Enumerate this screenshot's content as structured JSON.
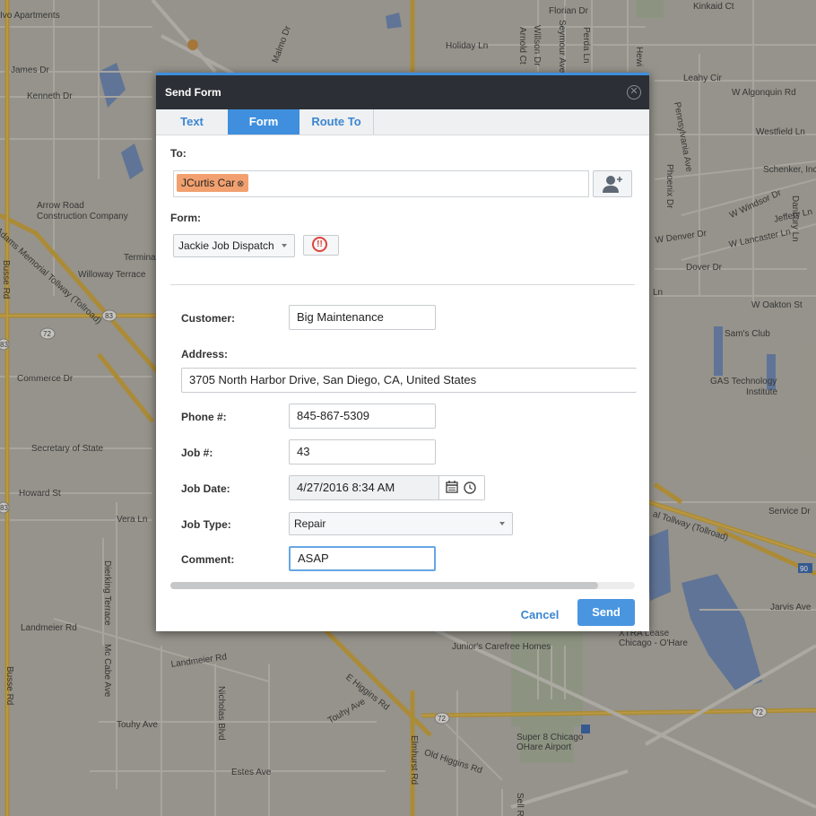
{
  "dialog": {
    "title": "Send Form",
    "close_icon": "close-circle-icon",
    "tabs": [
      {
        "label": "Text",
        "active": false
      },
      {
        "label": "Form",
        "active": true
      },
      {
        "label": "Route To",
        "active": false
      }
    ],
    "to_label": "To:",
    "recipient_chip": "JCurtis Car",
    "add_contact_icon": "add-user-icon",
    "form_label": "Form:",
    "form_selected": "Jackie Job Dispatch",
    "priority_icon": "priority-alert-icon",
    "fields": {
      "customer_label": "Customer:",
      "customer_value": "Big Maintenance",
      "address_label": "Address:",
      "address_value": "3705 North Harbor Drive, San Diego, CA, United States",
      "phone_label": "Phone #:",
      "phone_value": "845-867-5309",
      "job_label": "Job #:",
      "job_value": "43",
      "jobdate_label": "Job Date:",
      "jobdate_value": "4/27/2016 8:34 AM",
      "jobtype_label": "Job Type:",
      "jobtype_value": "Repair",
      "comment_label": "Comment:",
      "comment_value": "ASAP"
    },
    "cancel_label": "Cancel",
    "send_label": "Send",
    "colors": {
      "accent": "#3f8fde",
      "header": "#2c3036",
      "chip": "#f2a06f",
      "alert": "#e0433c"
    }
  },
  "map": {
    "labels": [
      "Ivo Apartments",
      "James Dr",
      "Kenneth Dr",
      "Arrow Road",
      "Construction Company",
      "Willoway Terrace",
      "Termina",
      "Commerce Dr",
      "Secretary of State",
      "Howard St",
      "Vera Ln",
      "Landmeier Rd",
      "Landmeier Rd",
      "Touhy Ave",
      "Estes Ave",
      "Busse Rd",
      "Busse Rd",
      "Dierking Terrace",
      "Mc Cabe Ave",
      "Nicholas Blvd",
      "Elmhurst Rd",
      "Sell R",
      "Holiday Ln",
      "Malmo Dr",
      "Arnold Ct",
      "Willson Dr",
      "Seymour Ave",
      "Perda Ln",
      "Hewi",
      "Florian Dr",
      "Kinkaid Ct",
      "Leahy Cir",
      "W Algonquin Rd",
      "Westfield Ln",
      "Schenker, Inc",
      "W Windsor Dr",
      "Jeffery Ln",
      "Danbury Ln",
      "W Denver Dr",
      "W Lancaster Ln",
      "Dover Dr",
      "Ln",
      "W Oakton St",
      "Sam's Club",
      "GAS Technology",
      "Institute",
      "Service Dr",
      "Jarvis Ave",
      "XTRA Lease",
      "Chicago - O'Hare",
      "Junior's Carefree Homes",
      "Super 8 Chicago",
      "OHare Airport",
      "Old Higgins Rd",
      "E Higgins Rd",
      "Touhy Ave",
      "Pennsylvania Ave",
      "Phoenix Dr",
      "al Tollway (Tollroad)",
      "Adams Memorial Tollway (Tollroad)",
      "83",
      "83",
      "72",
      "72",
      "72",
      "72",
      "83",
      "90"
    ]
  }
}
